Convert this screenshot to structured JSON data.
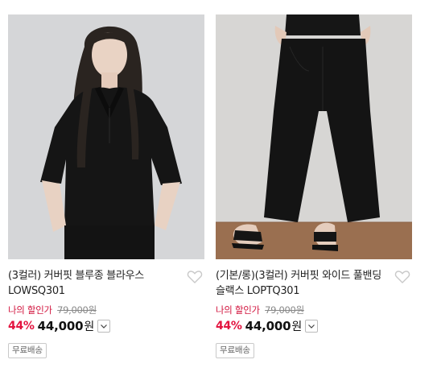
{
  "products": [
    {
      "name": "(3컬러) 커버핏 블루종 블라우스 LOWSQ301",
      "image_alt": "black short-sleeve collared blouse on model",
      "my_price_label": "나의 할인가",
      "original_price": "79,000원",
      "discount": "44%",
      "sale_price": "44,000",
      "currency": "원",
      "shipping_badge": "무료배송",
      "icons": {
        "wishlist": "heart-outline-icon",
        "dropdown": "chevron-down-icon"
      }
    },
    {
      "name": "(기본/롱)(3컬러) 커버핏 와이드 풀밴딩 슬랙스 LOPTQ301",
      "image_alt": "black wide leg slacks with sandals",
      "my_price_label": "나의 할인가",
      "original_price": "79,000원",
      "discount": "44%",
      "sale_price": "44,000",
      "currency": "원",
      "shipping_badge": "무료배송",
      "icons": {
        "wishlist": "heart-outline-icon",
        "dropdown": "chevron-down-icon"
      }
    }
  ],
  "colors": {
    "discount_red": "#e3133f",
    "label_red": "#d2163f",
    "text": "#222222"
  }
}
